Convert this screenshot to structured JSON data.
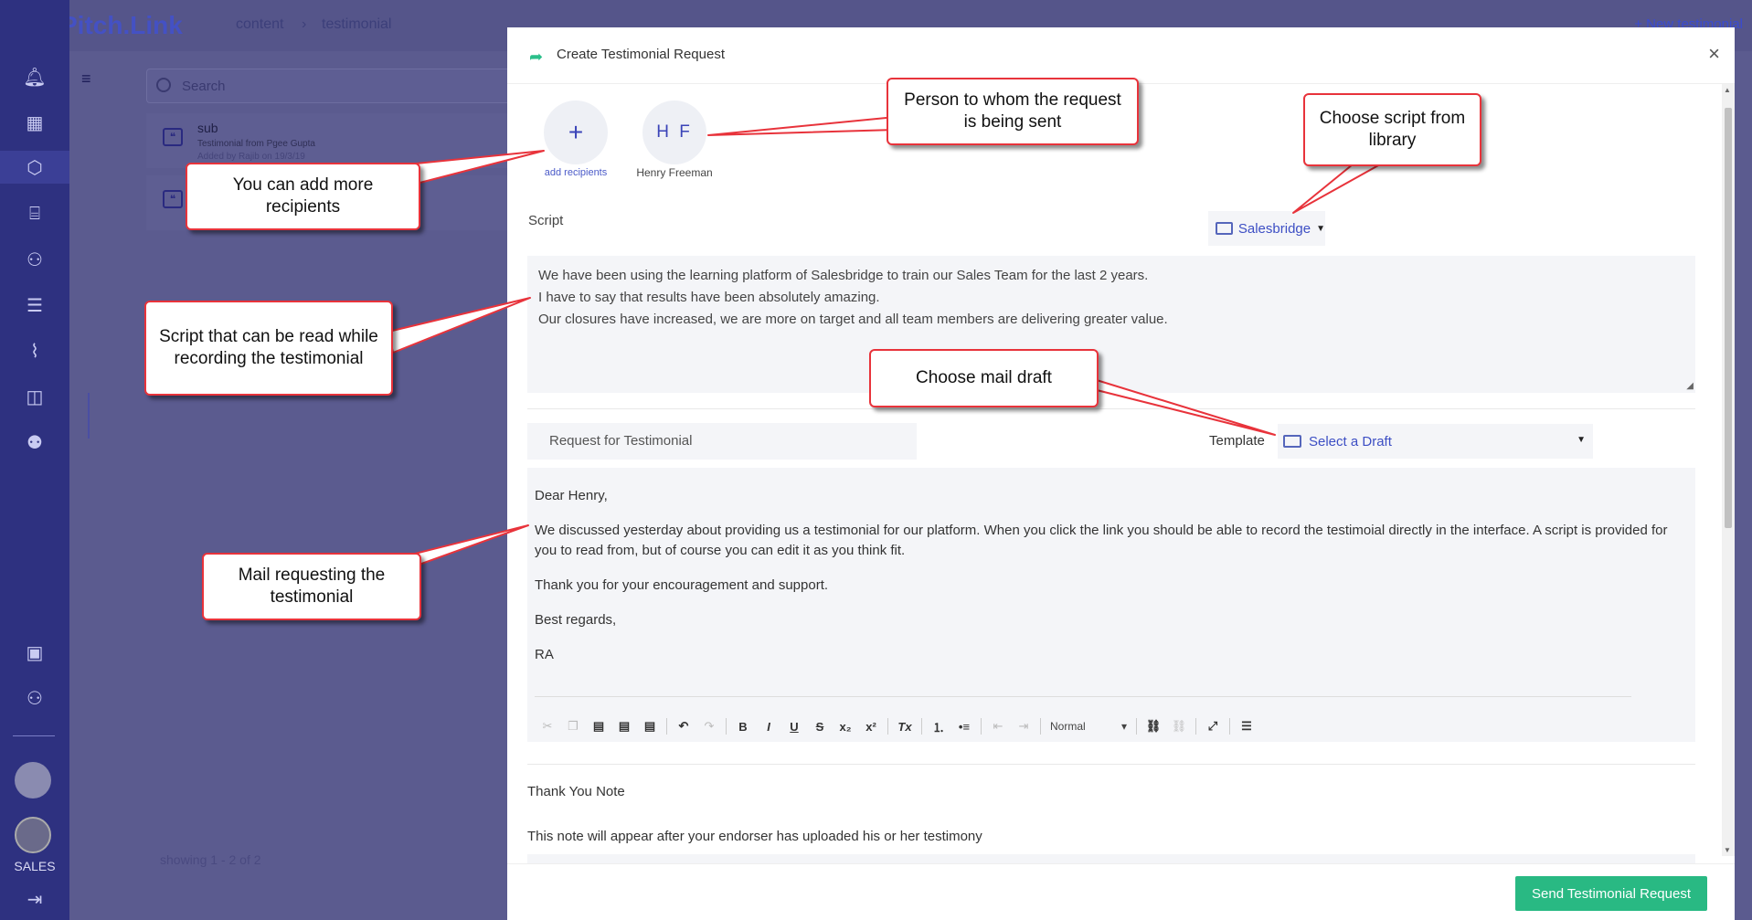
{
  "app": {
    "logo_text": "Pitch.Link",
    "breadcrumb": [
      "content",
      "testimonial"
    ],
    "new_testimonial": "+ New testimonial",
    "search_placeholder": "Search",
    "list_items": [
      {
        "title": "sub",
        "subtitle": "Testimonial from Pgee Gupta",
        "meta": "Added by Rajib on 19/3/19"
      }
    ],
    "showing_text": "showing 1 - 2 of 2",
    "sidebar_label": "SALES",
    "sidebar_icons": [
      "bell-icon",
      "dashboard-icon",
      "cube-icon",
      "presentation-icon",
      "user-network-icon",
      "chat-icon",
      "chart-icon",
      "book-icon",
      "team-icon",
      "calendar-add-icon",
      "user-add-icon",
      "logout-icon"
    ]
  },
  "modal": {
    "title": "Create Testimonial Request",
    "close": "×",
    "recipients": {
      "add_symbol": "+",
      "add_label": "add recipients",
      "person_initials": "H F",
      "person_name": "Henry Freeman"
    },
    "script": {
      "label": "Script",
      "library": "Salesbridge",
      "lines": [
        "We have been using the learning platform of Salesbridge to train our Sales Team for the last 2 years.",
        "I have to say that results have been absolutely amazing.",
        "Our closures have increased, we are more on target and all team members are delivering greater value."
      ]
    },
    "subject": "Request for Testimonial",
    "template_label": "Template",
    "template_value": "Select a Draft",
    "mail": {
      "greeting": "Dear Henry,",
      "body": "We discussed yesterday about providing us a testimonial for our platform. When you click the link you should be able to record the testimoial directly in the interface. A script is provided for you to read from, but of course you can edit it as you think fit.",
      "thanks": "Thank you for your encouragement and support.",
      "closing": "Best regards,",
      "signature": "RA"
    },
    "toolbar": {
      "format_select": "Normal",
      "buttons": [
        "cut-icon",
        "copy-icon",
        "paste-icon",
        "paste-text-icon",
        "paste-word-icon",
        "undo-icon",
        "redo-icon",
        "bold",
        "italic",
        "underline",
        "strikethrough",
        "subscript",
        "superscript",
        "clear-format",
        "numbered-list",
        "bulleted-list",
        "outdent",
        "indent",
        "link",
        "unlink",
        "maximize",
        "source"
      ]
    },
    "thank_you": {
      "label": "Thank You Note",
      "description": "This note will appear after your endorser has uploaded his or her testimony"
    },
    "send_button": "Send Testimonial Request"
  },
  "callouts": {
    "add_recipients": "You can add more recipients",
    "person": "Person to whom the request is being sent",
    "script_library": "Choose script from library",
    "script": "Script that can be read while recording the testimonial",
    "mail_draft": "Choose mail draft",
    "mail": "Mail requesting the testimonial"
  },
  "colors": {
    "accent": "#3d4fc4",
    "send": "#29b983",
    "callout_border": "#e8333b",
    "sidebar": "#2e3180"
  }
}
